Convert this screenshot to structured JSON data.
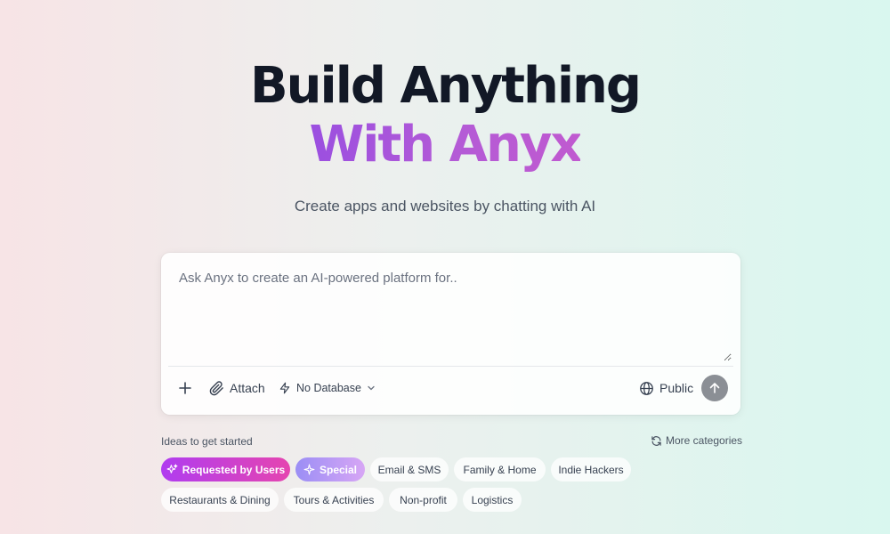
{
  "hero": {
    "title_line1": "Build Anything",
    "title_line2": "With Anyx",
    "subtitle": "Create apps and websites by chatting with AI"
  },
  "prompt": {
    "placeholder": "Ask Anyx to create an AI-powered platform for..",
    "value": ""
  },
  "toolbar": {
    "add_icon": "plus-icon",
    "attach_label": "Attach",
    "attach_icon": "paperclip-icon",
    "database_label": "No Database",
    "database_icon": "lightning-icon",
    "visibility_label": "Public",
    "visibility_icon": "globe-icon",
    "send_icon": "arrow-up-icon"
  },
  "ideas": {
    "label": "Ideas to get started",
    "more_label": "More categories",
    "chips": [
      {
        "label": "Requested by Users",
        "icon": "sparkles-icon"
      },
      {
        "label": "Special",
        "icon": "sparkle-star-icon"
      },
      {
        "label": "Email & SMS"
      },
      {
        "label": "Family & Home"
      },
      {
        "label": "Indie Hackers"
      },
      {
        "label": "Restaurants & Dining"
      },
      {
        "label": "Tours & Activities"
      },
      {
        "label": "Non-profit"
      },
      {
        "label": "Logistics"
      }
    ]
  },
  "colors": {
    "title_dark": "#121826",
    "title_gradient_start": "#9b4fe0",
    "title_gradient_end": "#c05ad0",
    "send_button": "#8b8f95",
    "requested_chip_start": "#b03cf0",
    "requested_chip_end": "#e545b0"
  }
}
